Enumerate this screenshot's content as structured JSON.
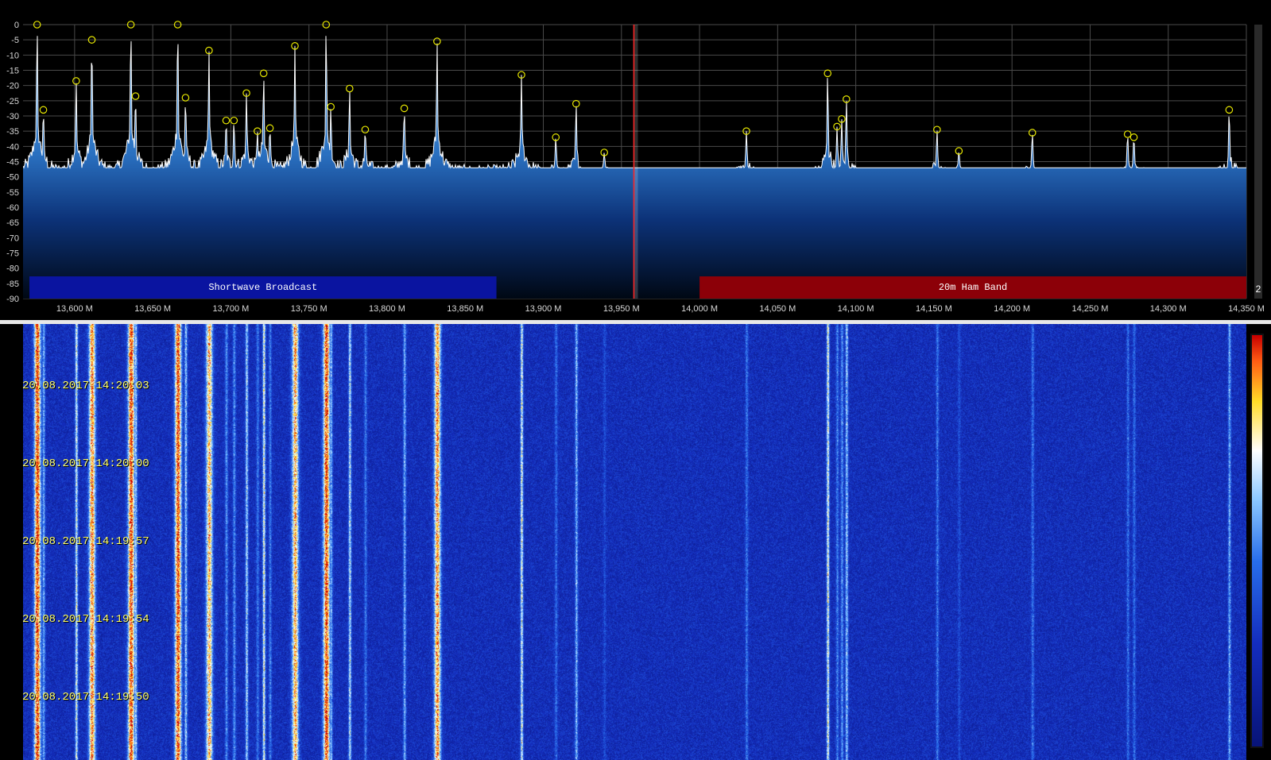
{
  "spectrum": {
    "y_labels": [
      "0",
      "-5",
      "-10",
      "-15",
      "-20",
      "-25",
      "-30",
      "-35",
      "-40",
      "-45",
      "-50",
      "-55",
      "-60",
      "-65",
      "-70",
      "-75",
      "-80",
      "-85",
      "-90"
    ],
    "x_labels": [
      "13,600 M",
      "13,650 M",
      "13,700 M",
      "13,750 M",
      "13,800 M",
      "13,850 M",
      "13,900 M",
      "13,950 M",
      "14,000 M",
      "14,050 M",
      "14,100 M",
      "14,150 M",
      "14,200 M",
      "14,250 M",
      "14,300 M",
      "14,350 M"
    ],
    "x_range_mhz": [
      13.567,
      14.35
    ],
    "y_range_db": [
      -90,
      0
    ],
    "center_marker_mhz": 13.959,
    "noise_floor_db": -47,
    "peaks_mhz_db": [
      [
        13.576,
        0
      ],
      [
        13.58,
        -28
      ],
      [
        13.601,
        -18.5
      ],
      [
        13.611,
        -5
      ],
      [
        13.636,
        0
      ],
      [
        13.639,
        -23.5
      ],
      [
        13.666,
        0
      ],
      [
        13.671,
        -24
      ],
      [
        13.686,
        -8.5
      ],
      [
        13.697,
        -31.5
      ],
      [
        13.702,
        -31.5
      ],
      [
        13.71,
        -22.5
      ],
      [
        13.717,
        -35
      ],
      [
        13.721,
        -16
      ],
      [
        13.725,
        -34
      ],
      [
        13.741,
        -7
      ],
      [
        13.761,
        0
      ],
      [
        13.764,
        -27
      ],
      [
        13.776,
        -21
      ],
      [
        13.786,
        -34.5
      ],
      [
        13.811,
        -27.5
      ],
      [
        13.832,
        -5.5
      ],
      [
        13.886,
        -16.5
      ],
      [
        13.908,
        -37
      ],
      [
        13.921,
        -26
      ],
      [
        13.939,
        -42
      ],
      [
        14.03,
        -35
      ],
      [
        14.082,
        -16
      ],
      [
        14.088,
        -33.5
      ],
      [
        14.091,
        -31
      ],
      [
        14.094,
        -24.5
      ],
      [
        14.152,
        -34.5
      ],
      [
        14.166,
        -41.5
      ],
      [
        14.213,
        -35.5
      ],
      [
        14.274,
        -36
      ],
      [
        14.278,
        -37
      ],
      [
        14.339,
        -28
      ]
    ],
    "bands": [
      {
        "label": "Shortwave Broadcast",
        "start_mhz": 13.57,
        "end_mhz": 13.87,
        "color": "#0a14a0"
      },
      {
        "label": "20m Ham Band",
        "start_mhz": 14.0,
        "end_mhz": 14.35,
        "color": "#8c0008"
      }
    ],
    "zoom_badge": "2"
  },
  "waterfall": {
    "timestamps": [
      "20.08.2017 14:20:03",
      "20.08.2017 14:20:00",
      "20.08.2017 14:19:57",
      "20.08.2017 14:19:54",
      "20.08.2017 14:19:50"
    ]
  },
  "colors": {
    "background": "#000000",
    "spectrum_fill_top": "#4aa0e8",
    "spectrum_fill_bottom": "#000814",
    "trace": "#ffffff",
    "peak_marker": "#e8e800",
    "waterfall_base": "#0a1a8c",
    "grid": "#555555",
    "center_line": "#ff2020"
  }
}
